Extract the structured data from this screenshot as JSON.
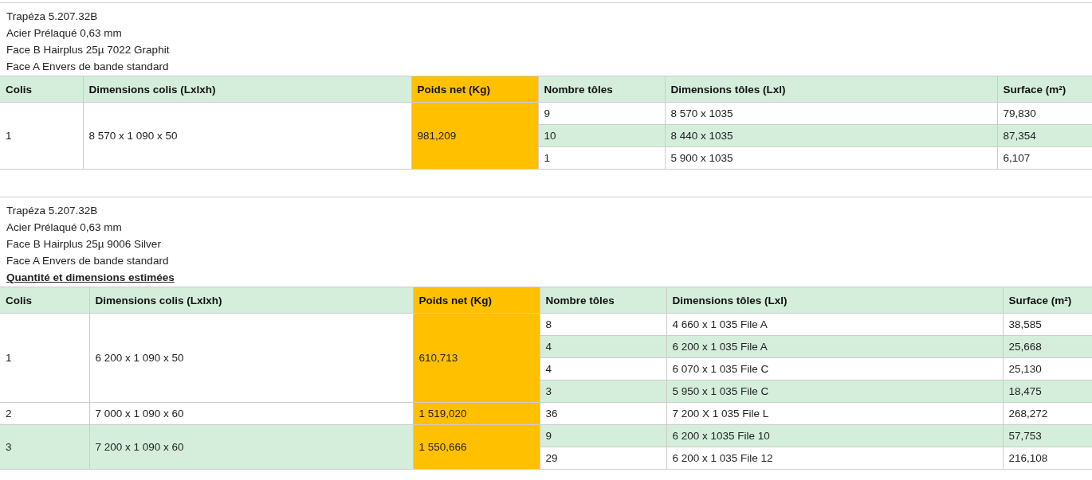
{
  "blocks": [
    {
      "lines": [
        "Trapéza 5.207.32B",
        "Acier Prélaqué 0,63 mm",
        "Face B Hairplus 25µ 7022 Graphit",
        "Face A Envers de bande standard"
      ],
      "table": {
        "columns": [
          "Colis",
          "Dimensions colis (Lxlxh)",
          "Poids net (Kg)",
          "Nombre tôles",
          "Dimensions tôles (Lxl)",
          "Surface (m²)"
        ],
        "colis": [
          {
            "number": "1",
            "dimensions": "8 570 x 1 090 x 50",
            "weight": "981,209",
            "highlighted": false,
            "sheets": [
              {
                "count": "9",
                "dimensions": "8 570 x 1035",
                "surface": "79,830",
                "highlighted": false
              },
              {
                "count": "10",
                "dimensions": "8 440 x 1035",
                "surface": "87,354",
                "highlighted": true
              },
              {
                "count": "1",
                "dimensions": "5 900 x 1035",
                "surface": "6,107",
                "highlighted": false
              }
            ]
          }
        ]
      }
    },
    {
      "lines": [
        "Trapéza 5.207.32B",
        "Acier Prélaqué 0,63 mm",
        "Face B Hairplus 25µ 9006 Silver",
        "Face A Envers de bande standard"
      ],
      "note": "Quantité et dimensions estimées",
      "table": {
        "columns": [
          "Colis",
          "Dimensions colis (Lxlxh)",
          "Poids net (Kg)",
          "Nombre tôles",
          "Dimensions tôles (Lxl)",
          "Surface (m²)"
        ],
        "colis": [
          {
            "number": "1",
            "dimensions": "6 200 x 1 090 x 50",
            "weight": "610,713",
            "highlighted": false,
            "sheets": [
              {
                "count": "8",
                "dimensions": "4 660 x 1 035 File A",
                "surface": "38,585",
                "highlighted": false
              },
              {
                "count": "4",
                "dimensions": "6 200 x 1 035 File A",
                "surface": "25,668",
                "highlighted": true
              },
              {
                "count": "4",
                "dimensions": "6 070 x 1 035 File C",
                "surface": "25,130",
                "highlighted": false
              },
              {
                "count": "3",
                "dimensions": "5 950 x 1 035 File C",
                "surface": "18,475",
                "highlighted": true
              }
            ]
          },
          {
            "number": "2",
            "dimensions": "7 000 x 1 090 x 60",
            "weight": "1 519,020",
            "highlighted": false,
            "sheets": [
              {
                "count": "36",
                "dimensions": "7 200 X 1 035 File L",
                "surface": "268,272",
                "highlighted": false
              }
            ]
          },
          {
            "number": "3",
            "dimensions": "7 200 x 1 090 x 60",
            "weight": "1 550,666",
            "highlighted": true,
            "sheets": [
              {
                "count": "9",
                "dimensions": "6 200 x 1035 File 10",
                "surface": "57,753",
                "highlighted": true
              },
              {
                "count": "29",
                "dimensions": "6 200 x 1 035 File 12",
                "surface": "216,108",
                "highlighted": false
              }
            ]
          }
        ]
      }
    }
  ]
}
